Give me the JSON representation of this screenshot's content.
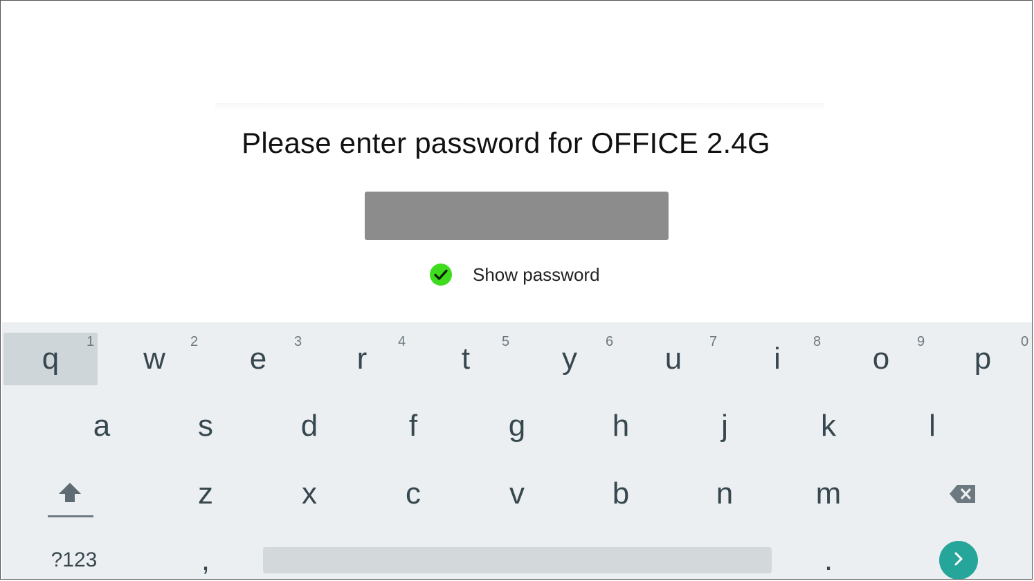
{
  "dialog": {
    "title": "Please enter password for OFFICE 2.4G",
    "password_value": "",
    "show_password_label": "Show password",
    "show_password_checked": true
  },
  "keyboard": {
    "row1": [
      {
        "label": "q",
        "hint": "1"
      },
      {
        "label": "w",
        "hint": "2"
      },
      {
        "label": "e",
        "hint": "3"
      },
      {
        "label": "r",
        "hint": "4"
      },
      {
        "label": "t",
        "hint": "5"
      },
      {
        "label": "y",
        "hint": "6"
      },
      {
        "label": "u",
        "hint": "7"
      },
      {
        "label": "i",
        "hint": "8"
      },
      {
        "label": "o",
        "hint": "9"
      },
      {
        "label": "p",
        "hint": "0"
      }
    ],
    "row2": [
      "a",
      "s",
      "d",
      "f",
      "g",
      "h",
      "j",
      "k",
      "l"
    ],
    "row3": [
      "z",
      "x",
      "c",
      "v",
      "b",
      "n",
      "m"
    ],
    "symbols_label": "?123",
    "comma_label": ",",
    "period_label": ".",
    "pressed_key": "q"
  },
  "colors": {
    "check": "#3ddc1c",
    "keyboard_bg": "#eceff1",
    "action_button": "#26a69a"
  },
  "icons": {
    "check": "check-icon",
    "shift": "shift-icon",
    "backspace": "backspace-icon",
    "enter": "chevron-right-icon"
  }
}
